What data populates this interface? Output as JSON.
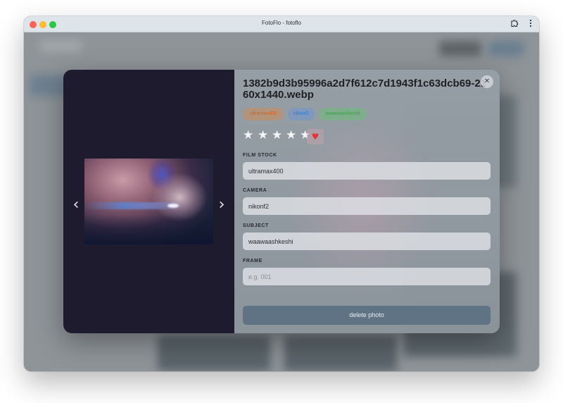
{
  "window": {
    "title": "FotoFlo - fotoflo",
    "extension_icon": "puzzle-piece-icon",
    "menu_icon": "kebab-menu-icon"
  },
  "photo_modal": {
    "filename": "1382b9d3b95996a2d7f612c7d1943f1c63dcb69-2160x1440.webp",
    "close_icon": "✕",
    "prev_arrow": "‹",
    "next_arrow": "›",
    "tags": [
      "ultramax400",
      "nikonf2",
      "waawaashkeshi"
    ],
    "rating": {
      "value": 0,
      "max": 5,
      "star_glyph": "★"
    },
    "favorite": {
      "glyph": "♥",
      "color": "#e5323c",
      "active": true
    },
    "fields": {
      "film_stock": {
        "label": "FILM STOCK",
        "value": "ultramax400",
        "placeholder": ""
      },
      "camera": {
        "label": "CAMERA",
        "value": "nikonf2",
        "placeholder": ""
      },
      "subject": {
        "label": "SUBJECT",
        "value": "waawaashkeshi",
        "placeholder": ""
      },
      "frame": {
        "label": "FRAME",
        "value": "",
        "placeholder": "e.g. 001"
      }
    },
    "delete_label": "delete photo"
  },
  "colors": {
    "modal_left_bg": "#1f1b2e",
    "delete_button": "#5f7385",
    "tag_orange": "#c8661e",
    "tag_blue": "#3a78c8",
    "tag_green": "#3aa04a"
  }
}
